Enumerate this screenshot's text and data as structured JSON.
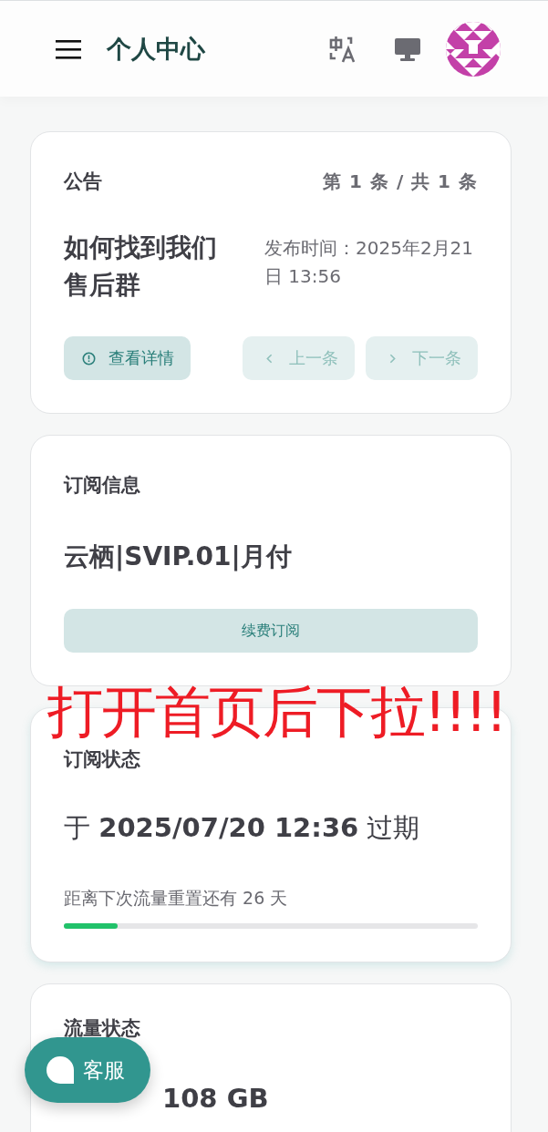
{
  "header": {
    "title": "个人中心"
  },
  "announcement": {
    "title": "公告",
    "counter": "第 1 条 / 共 1 条",
    "headline": "如何找到我们售后群",
    "published": "发布时间：2025年2月21日 13:56",
    "buttons": [
      {
        "kind": "detail",
        "label": "查看详情",
        "disabled": false
      },
      {
        "kind": "prev",
        "label": "上一条",
        "disabled": true
      },
      {
        "kind": "next",
        "label": "下一条",
        "disabled": true
      }
    ]
  },
  "subscription": {
    "title": "订阅信息",
    "plan": "云栖|SVIP.01|月付",
    "button": "续费订阅"
  },
  "annotation": "打开首页后下拉!!!!",
  "status": {
    "title": "订阅状态",
    "expiry": "于 **2025/07/20 12:36** 过期",
    "reset_text": "距离下次流量重置还有 26 天",
    "level": 0.13
  },
  "traffic": {
    "title": "流量状态",
    "usage": "108 GB"
  },
  "support_button": "客服"
}
